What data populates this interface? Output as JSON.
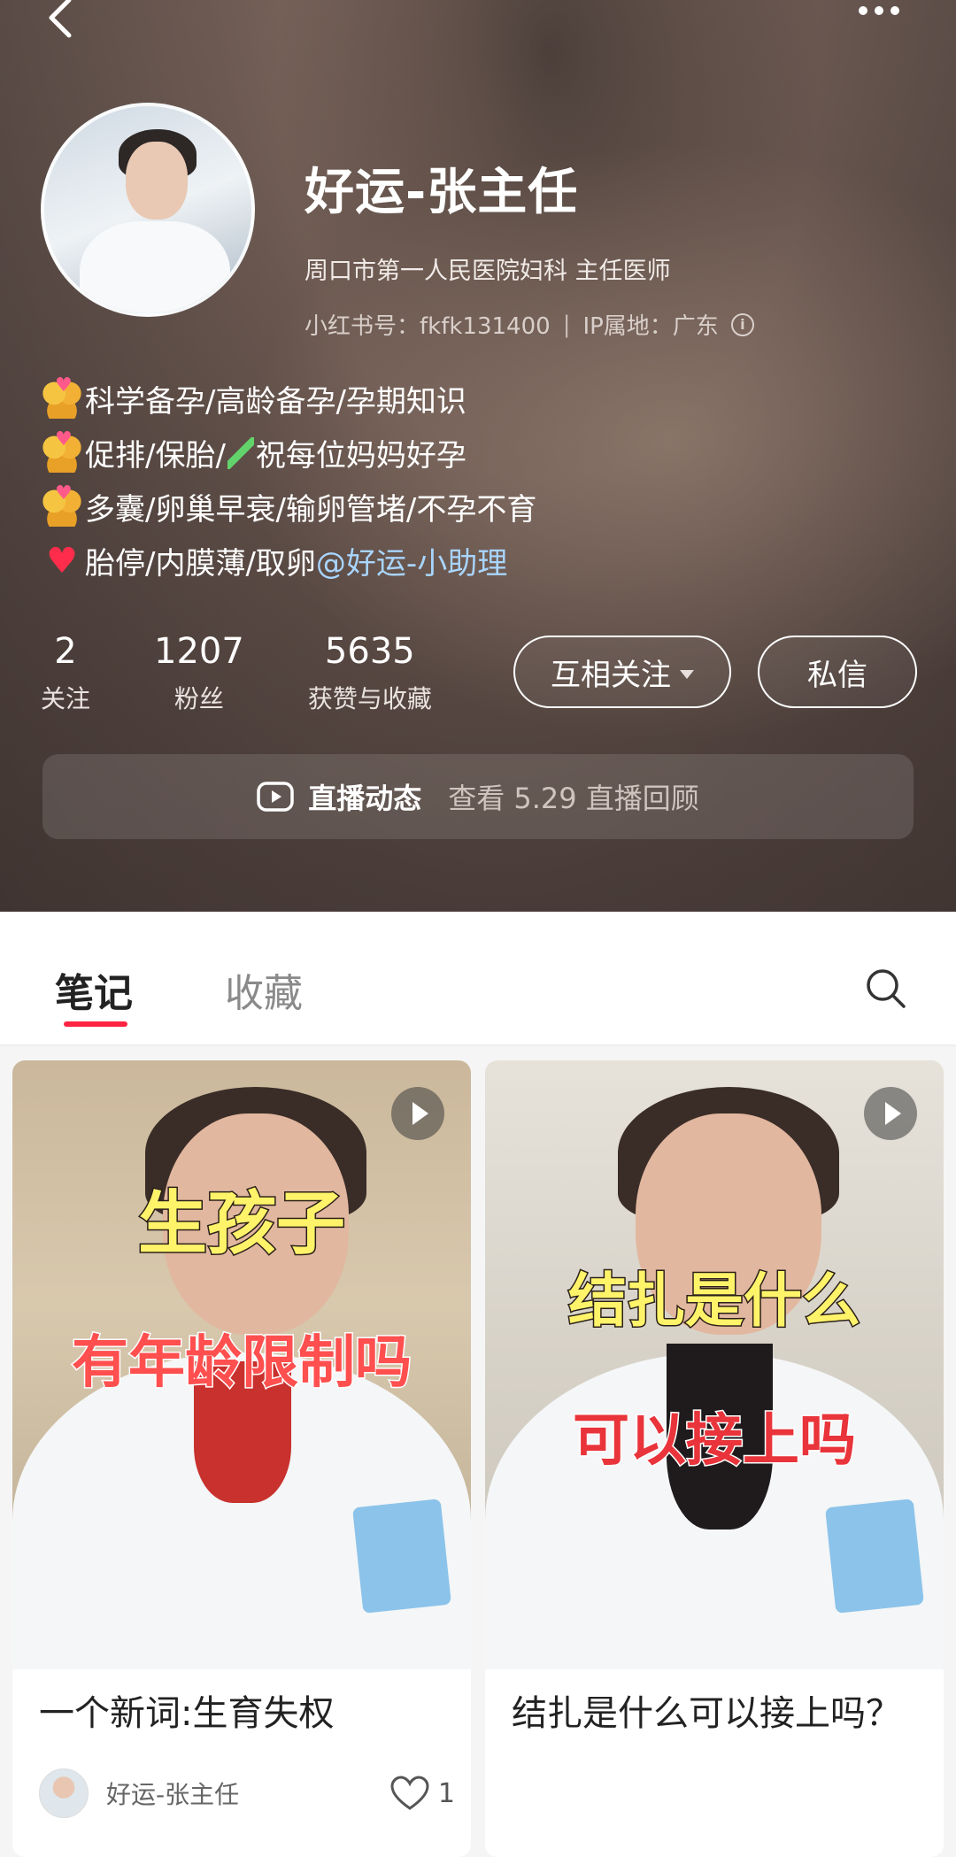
{
  "profile": {
    "name": "好运-张主任",
    "subtitle": "周口市第一人民医院妇科 主任医师",
    "id_label": "小红书号：fkfk131400",
    "ip_label": "IP属地：广东",
    "bio": {
      "line1": "科学备孕/高龄备孕/孕期知识",
      "line2a": "促排/保胎/",
      "line2b": "祝每位妈妈好孕",
      "line3": "多囊/卵巢早衰/输卵管堵/不孕不育",
      "line4": "胎停/内膜薄/取卵",
      "line4_mention": "@好运-小助理"
    }
  },
  "stats": [
    {
      "value": "2",
      "label": "关注"
    },
    {
      "value": "1207",
      "label": "粉丝"
    },
    {
      "value": "5635",
      "label": "获赞与收藏"
    }
  ],
  "buttons": {
    "follow": "互相关注",
    "message": "私信"
  },
  "live": {
    "label": "直播动态",
    "desc": "查看 5.29 直播回顾"
  },
  "tabs": {
    "notes": "笔记",
    "favorites": "收藏"
  },
  "notes": [
    {
      "overlay_top": "生孩子",
      "overlay_bottom": "有年龄限制吗",
      "title": "一个新词:生育失权",
      "author": "好运-张主任",
      "likes": "1"
    },
    {
      "overlay_top": "结扎是什么",
      "overlay_bottom": "可以接上吗",
      "title": "结扎是什么可以接上吗？"
    }
  ],
  "icons": [
    "back-icon",
    "more-icon",
    "info-icon",
    "couple-emoji-icon",
    "test-tube-emoji-icon",
    "heart-emoji-icon",
    "chevron-down-icon",
    "live-camera-icon",
    "search-icon",
    "play-icon",
    "heart-outline-icon"
  ],
  "colors": {
    "accent": "#ff2442",
    "mention": "#a9d5ff"
  }
}
